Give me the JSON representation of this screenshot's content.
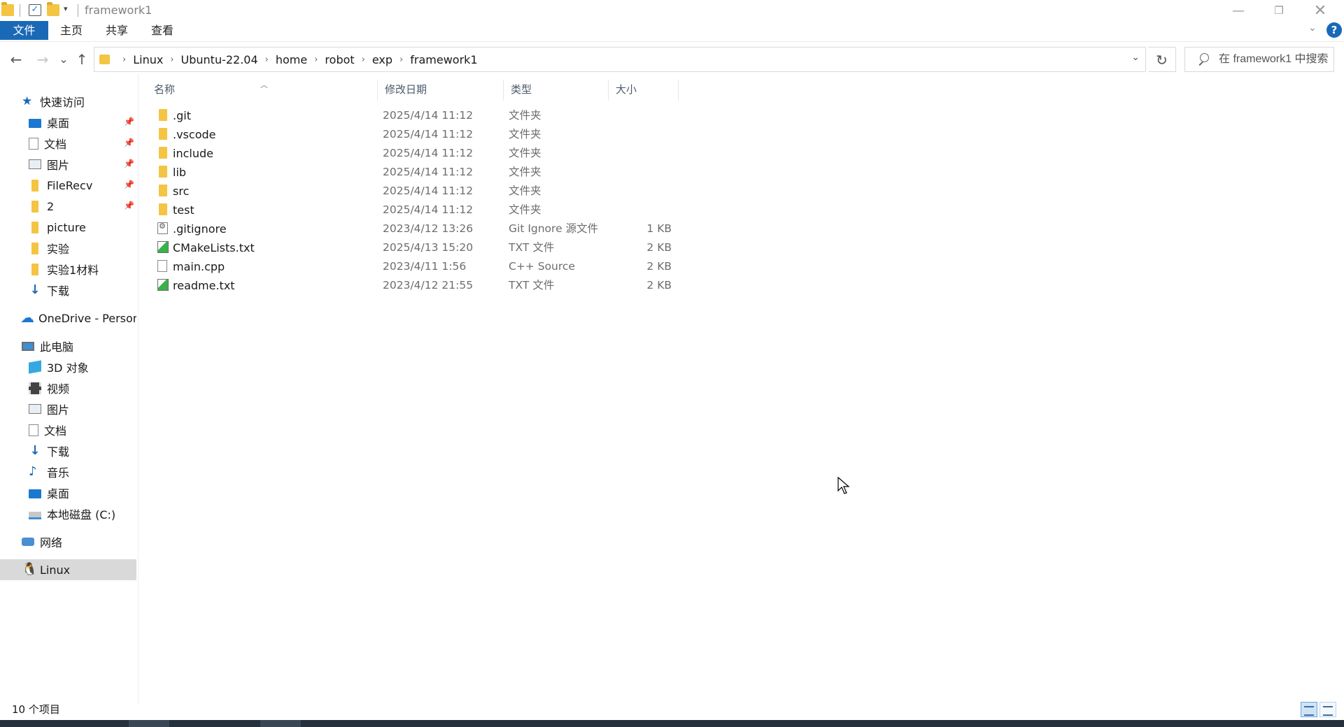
{
  "window": {
    "title": "framework1"
  },
  "ribbon": {
    "tabs": [
      "文件",
      "主页",
      "共享",
      "查看"
    ]
  },
  "nav": {
    "back": "←",
    "forward": "→",
    "recent": "⌄",
    "up": "↑",
    "breadcrumb": [
      "Linux",
      "Ubuntu-22.04",
      "home",
      "robot",
      "exp",
      "framework1"
    ],
    "search_placeholder": "在 framework1 中搜索"
  },
  "sidebar": {
    "quick_access": "快速访问",
    "quick_items": [
      {
        "label": "桌面",
        "icon": "desktop-icon",
        "pinned": true
      },
      {
        "label": "文档",
        "icon": "document-icon",
        "pinned": true
      },
      {
        "label": "图片",
        "icon": "picture-icon",
        "pinned": true
      },
      {
        "label": "FileRecv",
        "icon": "folder-icon",
        "pinned": true
      },
      {
        "label": "2",
        "icon": "folder-icon",
        "pinned": true
      },
      {
        "label": "picture",
        "icon": "folder-icon",
        "pinned": false
      },
      {
        "label": "实验",
        "icon": "folder-icon",
        "pinned": false
      },
      {
        "label": "实验1材料",
        "icon": "folder-icon",
        "pinned": false
      },
      {
        "label": "下载",
        "icon": "download-icon",
        "pinned": false
      }
    ],
    "onedrive": "OneDrive - Persona",
    "this_pc": "此电脑",
    "pc_items": [
      {
        "label": "3D 对象",
        "icon": "3d-objects-icon"
      },
      {
        "label": "视频",
        "icon": "video-icon"
      },
      {
        "label": "图片",
        "icon": "picture-icon"
      },
      {
        "label": "文档",
        "icon": "document-icon"
      },
      {
        "label": "下载",
        "icon": "download-icon"
      },
      {
        "label": "音乐",
        "icon": "music-icon"
      },
      {
        "label": "桌面",
        "icon": "desktop-icon"
      },
      {
        "label": "本地磁盘 (C:)",
        "icon": "local-disk-icon"
      }
    ],
    "network": "网络",
    "linux": "Linux"
  },
  "columns": {
    "name": "名称",
    "date": "修改日期",
    "type": "类型",
    "size": "大小"
  },
  "files": [
    {
      "name": ".git",
      "date": "2025/4/14 11:12",
      "type": "文件夹",
      "size": "",
      "icon": "folder-icon"
    },
    {
      "name": ".vscode",
      "date": "2025/4/14 11:12",
      "type": "文件夹",
      "size": "",
      "icon": "folder-icon"
    },
    {
      "name": "include",
      "date": "2025/4/14 11:12",
      "type": "文件夹",
      "size": "",
      "icon": "folder-icon"
    },
    {
      "name": "lib",
      "date": "2025/4/14 11:12",
      "type": "文件夹",
      "size": "",
      "icon": "folder-icon"
    },
    {
      "name": "src",
      "date": "2025/4/14 11:12",
      "type": "文件夹",
      "size": "",
      "icon": "folder-icon"
    },
    {
      "name": "test",
      "date": "2025/4/14 11:12",
      "type": "文件夹",
      "size": "",
      "icon": "folder-icon"
    },
    {
      "name": ".gitignore",
      "date": "2023/4/12 13:26",
      "type": "Git Ignore 源文件",
      "size": "1 KB",
      "icon": "gitignore-file-icon"
    },
    {
      "name": "CMakeLists.txt",
      "date": "2025/4/13 15:20",
      "type": "TXT 文件",
      "size": "2 KB",
      "icon": "text-file-icon"
    },
    {
      "name": "main.cpp",
      "date": "2023/4/11 1:56",
      "type": "C++ Source",
      "size": "2 KB",
      "icon": "cpp-file-icon"
    },
    {
      "name": "readme.txt",
      "date": "2023/4/12 21:55",
      "type": "TXT 文件",
      "size": "2 KB",
      "icon": "text-file-icon"
    }
  ],
  "status": {
    "item_count": "10 个项目"
  },
  "colors": {
    "accent": "#1a69b7",
    "folder": "#f4c443",
    "selected_bg": "#d9d9d9"
  }
}
